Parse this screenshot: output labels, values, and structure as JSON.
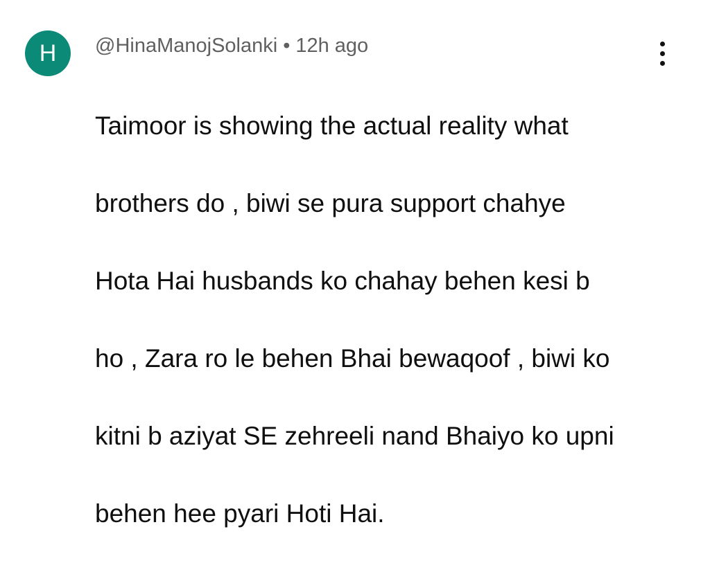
{
  "comment": {
    "avatar_letter": "H",
    "avatar_color": "#0c8a78",
    "author": "@HinaManojSolanki",
    "separator": "•",
    "timestamp": "12h ago",
    "lines": [
      "Taimoor is showing the actual reality what",
      "brothers do , biwi se pura support chahye",
      "Hota Hai husbands ko chahay behen kesi b",
      "ho , Zara ro le behen Bhai bewaqoof , biwi ko",
      "kitni b aziyat SE zehreeli nand Bhaiyo ko upni",
      "behen hee pyari Hoti Hai."
    ],
    "menu_icon": "more-vertical-icon"
  }
}
